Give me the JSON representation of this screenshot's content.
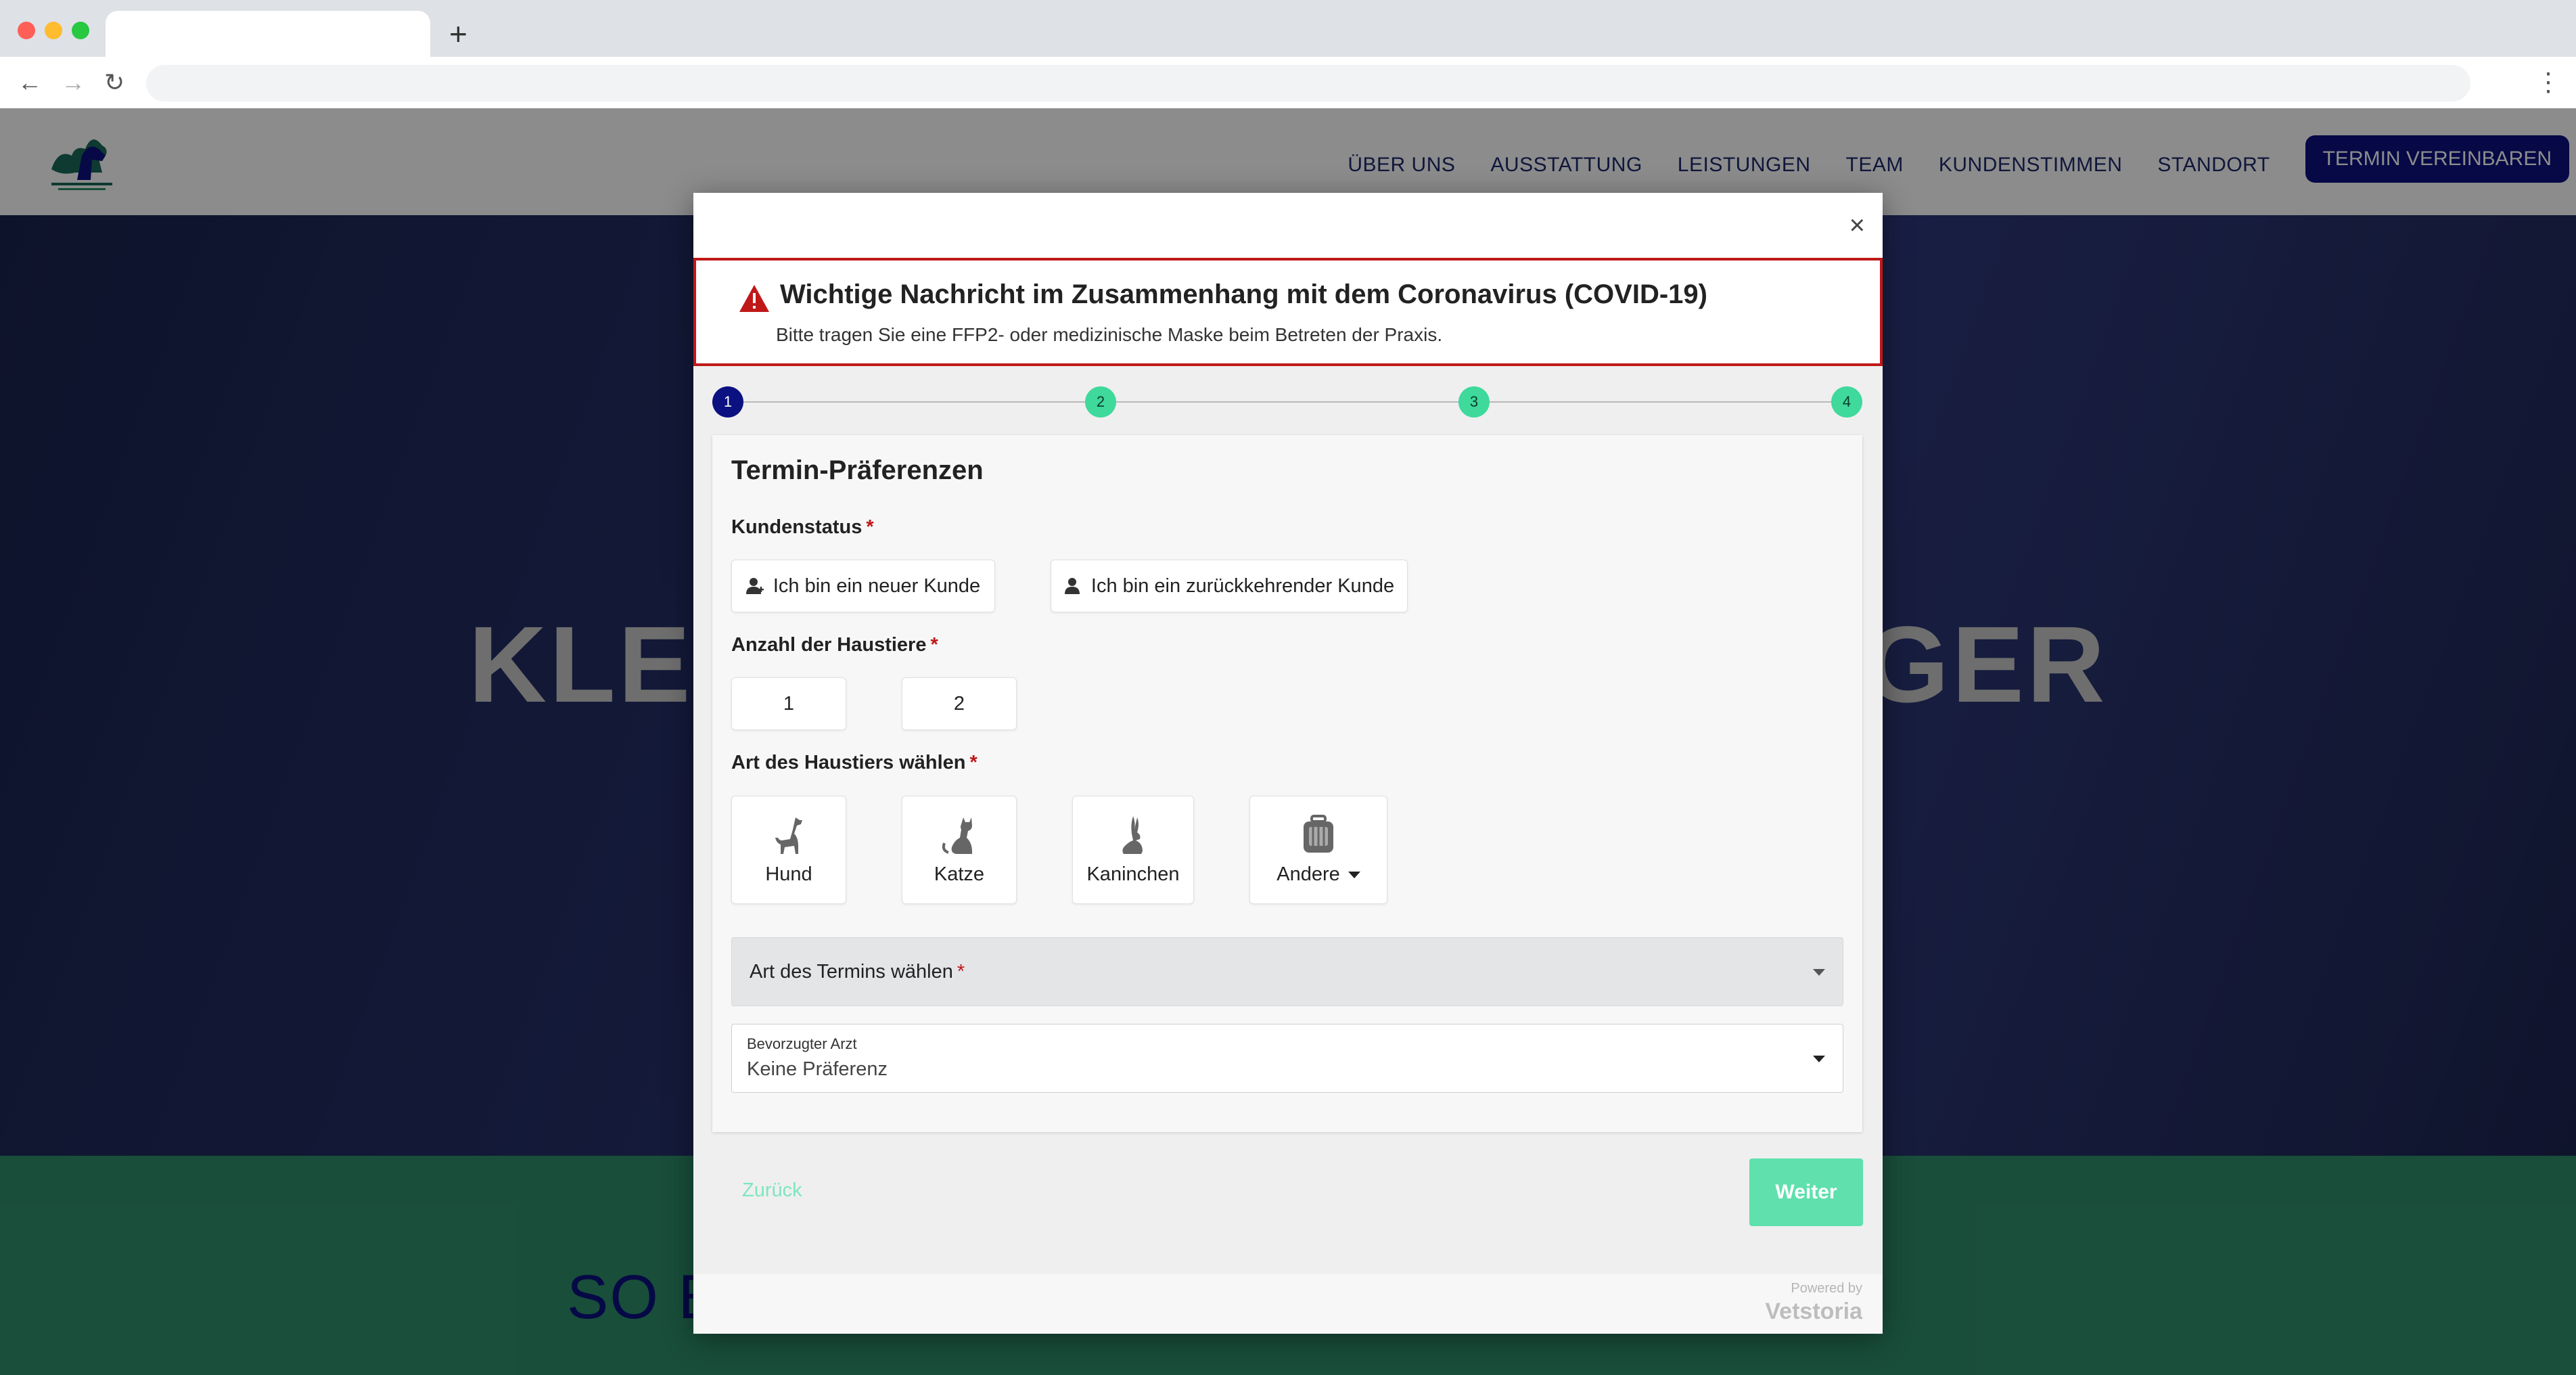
{
  "browser": {
    "tab_title": "",
    "new_tab": "+",
    "url": ""
  },
  "site": {
    "nav": [
      "ÜBER UNS",
      "AUSSTATTUNG",
      "LEISTUNGEN",
      "TEAM",
      "KUNDENSTIMMEN",
      "STANDORT"
    ],
    "nav_cta": "TERMIN VEREINBAREN",
    "hero_title": "KLEIN                             EIGER",
    "section_heading": "SO E"
  },
  "modal": {
    "close": "×",
    "alert": {
      "title": "Wichtige Nachricht im Zusammenhang mit dem Coronavirus (COVID-19)",
      "body": "Bitte tragen Sie eine FFP2- oder medizinische Maske beim Betreten der Praxis."
    },
    "steps": [
      "1",
      "2",
      "3",
      "4"
    ],
    "card_title": "Termin-Präferenzen",
    "customer_status": {
      "label": "Kundenstatus",
      "required": "*",
      "new": "Ich bin ein neuer Kunde",
      "returning": "Ich bin ein zurückkehrender Kunde"
    },
    "pet_count": {
      "label": "Anzahl der Haustiere",
      "required": "*",
      "options": [
        "1",
        "2"
      ]
    },
    "pet_type": {
      "label": "Art des Haustiers wählen",
      "required": "*",
      "options": [
        "Hund",
        "Katze",
        "Kaninchen",
        "Andere"
      ]
    },
    "appointment_type": {
      "label": "Art des Termins wählen",
      "required": "*"
    },
    "doctor": {
      "label": "Bevorzugter Arzt",
      "value": "Keine Präferenz"
    },
    "back": "Zurück",
    "next": "Weiter",
    "powered_by": "Powered by",
    "brand": "Vetstoria"
  }
}
